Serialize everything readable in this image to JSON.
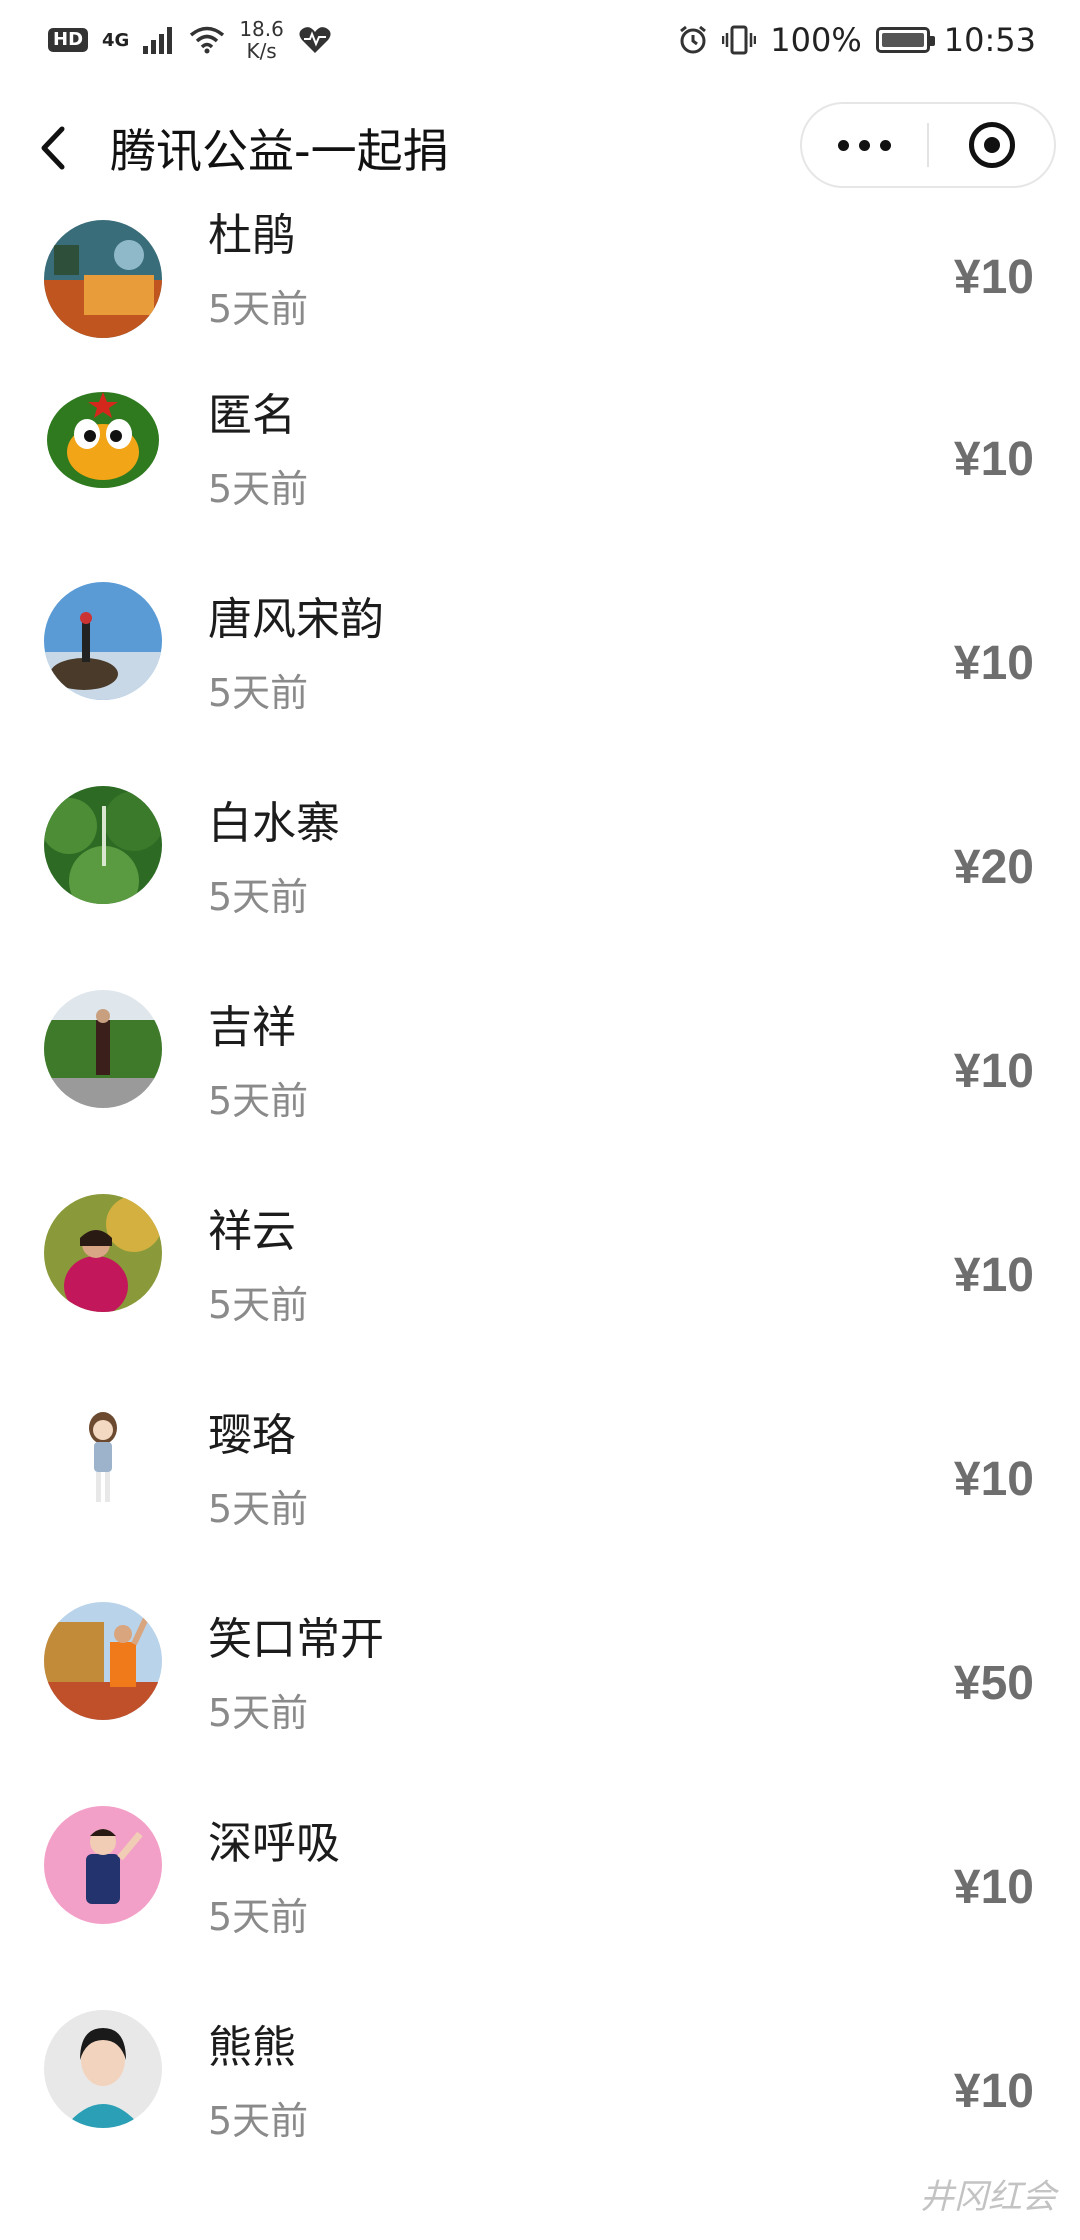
{
  "status_bar": {
    "hd": "HD",
    "network": "4G",
    "speed_value": "18.6",
    "speed_unit": "K/s",
    "battery": "100%",
    "time": "10:53"
  },
  "nav": {
    "title": "腾讯公益-一起捐"
  },
  "donors": [
    {
      "name": "杜鹃",
      "time": "5天前",
      "amount": "¥10"
    },
    {
      "name": "匿名",
      "time": "5天前",
      "amount": "¥10"
    },
    {
      "name": "唐风宋韵",
      "time": "5天前",
      "amount": "¥10"
    },
    {
      "name": "白水寨",
      "time": "5天前",
      "amount": "¥20"
    },
    {
      "name": "吉祥 ",
      "time": "5天前",
      "amount": "¥10"
    },
    {
      "name": "祥云",
      "time": "5天前",
      "amount": "¥10"
    },
    {
      "name": "璎珞",
      "time": "5天前",
      "amount": "¥10"
    },
    {
      "name": "笑口常开",
      "time": "5天前",
      "amount": "¥50"
    },
    {
      "name": "深呼吸",
      "time": "5天前",
      "amount": "¥10"
    },
    {
      "name": "熊熊",
      "time": "5天前",
      "amount": "¥10"
    }
  ],
  "watermark": "井冈红会",
  "colors": {
    "amount": "#6e6e6e",
    "time": "#8a8a8a",
    "name": "#1c1c1c"
  }
}
